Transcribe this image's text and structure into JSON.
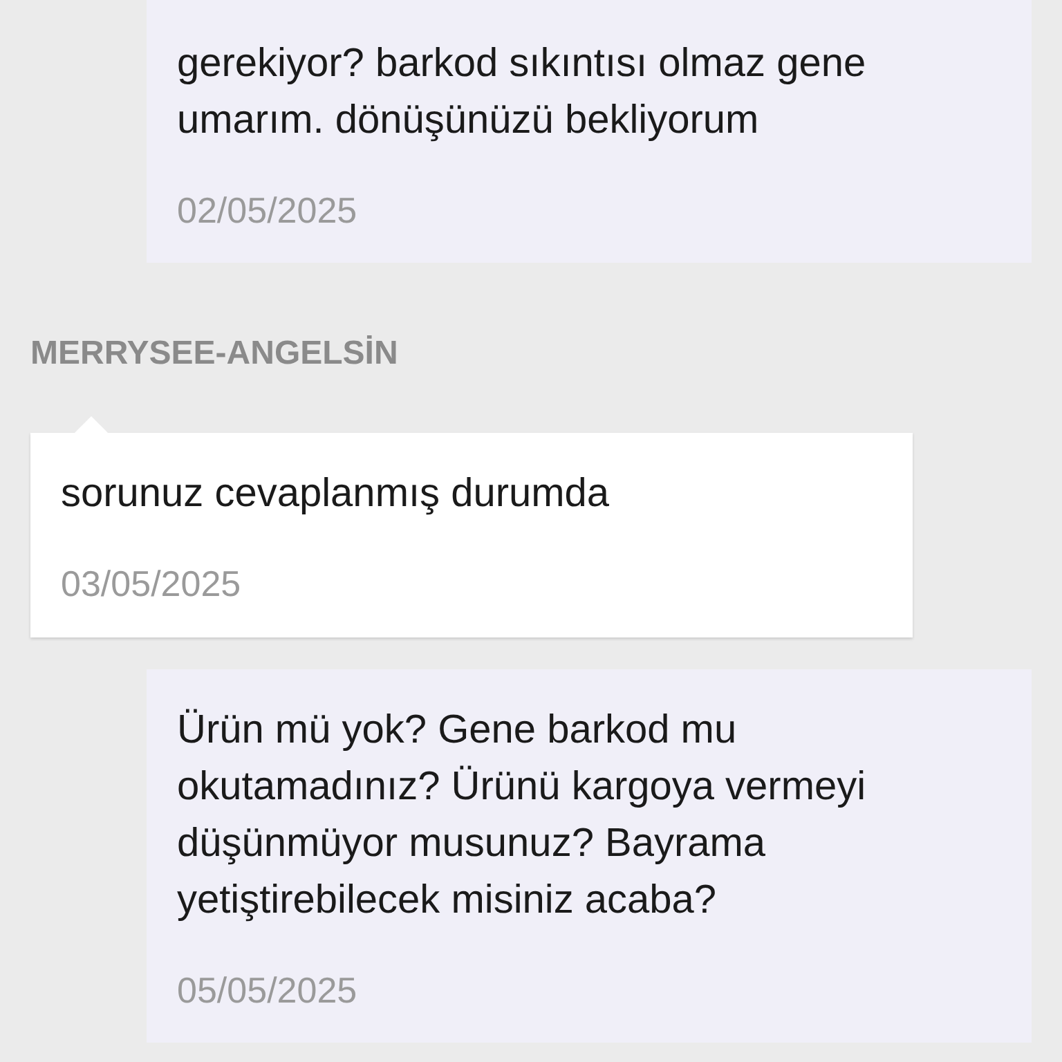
{
  "messages": [
    {
      "kind": "mine",
      "text": "gerekiyor? barkod sıkıntısı olmaz gene\numarım. dönüşünüzü bekliyorum",
      "date": "02/05/2025"
    },
    {
      "kind": "theirs",
      "sender": "MERRYSEE-ANGELSİN",
      "text": "sorunuz cevaplanmış durumda",
      "date": "03/05/2025"
    },
    {
      "kind": "mine",
      "text": "Ürün mü yok? Gene barkod mu\nokutamadınız? Ürünü kargoya vermeyi\ndüşünmüyor musunuz? Bayrama\nyetiştirebilecek misiniz acaba?",
      "date": "05/05/2025"
    }
  ]
}
